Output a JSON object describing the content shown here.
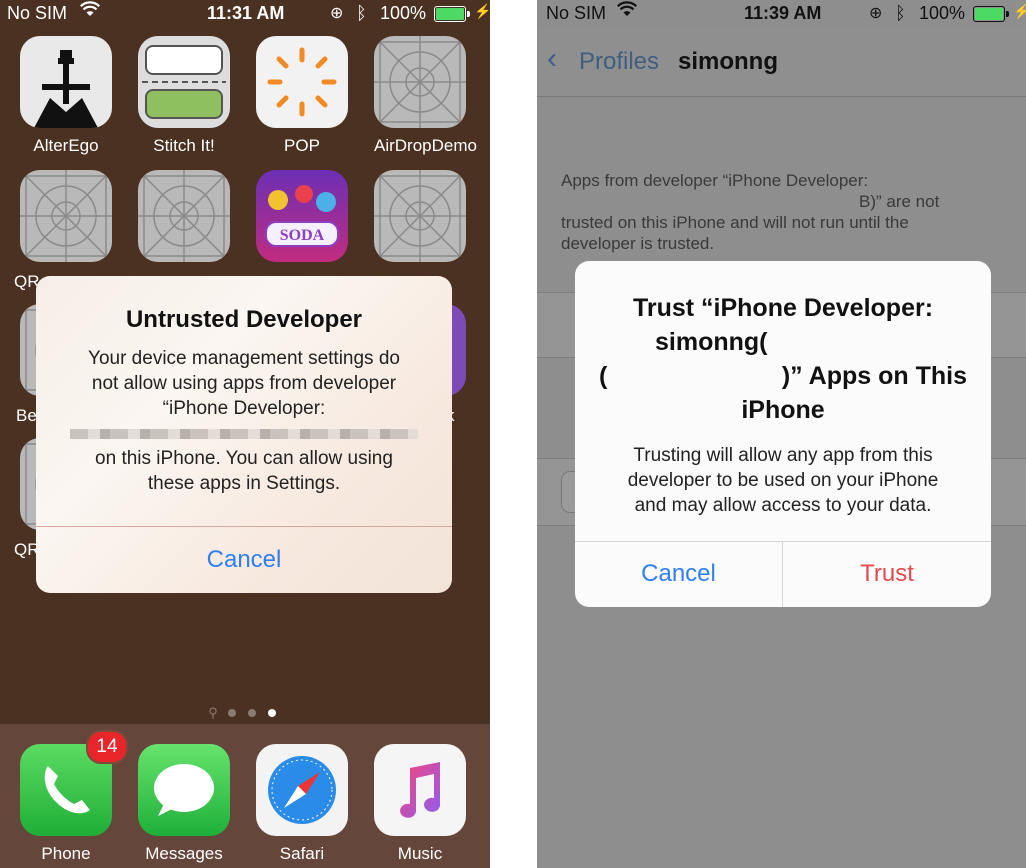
{
  "left": {
    "status": {
      "carrier": "No SIM",
      "time": "11:31 AM",
      "battery": "100%"
    },
    "apps": [
      {
        "label": "AlterEgo",
        "icon": "alterego-icon"
      },
      {
        "label": "Stitch It!",
        "icon": "stitch-icon"
      },
      {
        "label": "POP",
        "icon": "pop-icon"
      },
      {
        "label": "AirDropDemo",
        "icon": "placeholder-icon"
      },
      {
        "label": "QR",
        "icon": "placeholder-icon"
      },
      {
        "label": "",
        "icon": "placeholder-icon"
      },
      {
        "label": "",
        "icon": "candy-soda-icon"
      },
      {
        "label": "",
        "icon": "placeholder-icon"
      },
      {
        "label": "Be",
        "icon": "placeholder-icon"
      },
      {
        "label": "k",
        "icon": "purple-icon"
      },
      {
        "label": "QR",
        "icon": "placeholder-icon"
      }
    ],
    "dock": [
      {
        "label": "Phone",
        "badge": "14"
      },
      {
        "label": "Messages"
      },
      {
        "label": "Safari"
      },
      {
        "label": "Music"
      }
    ],
    "alert": {
      "title": "Untrusted Developer",
      "line1": "Your device management settings do",
      "line2": "not allow using apps from developer",
      "line3": "“iPhone Developer:",
      "line4": "on this iPhone. You can allow using",
      "line5": "these apps in Settings.",
      "cancel": "Cancel"
    }
  },
  "right": {
    "status": {
      "carrier": "No SIM",
      "time": "11:39 AM",
      "battery": "100%"
    },
    "nav": {
      "back": "Profiles",
      "title": "simonng"
    },
    "body": {
      "line1": "Apps from developer “iPhone Developer:",
      "line2": "B)” are not",
      "line3": "trusted on this iPhone and will not run until the",
      "line4": "developer is trusted."
    },
    "alert": {
      "title1": "Trust “iPhone Developer:",
      "title2": "simonng(",
      "title3": "(",
      "title3b": ")” Apps on This",
      "title4": "iPhone",
      "msg1": "Trusting will allow any app from this",
      "msg2": "developer to be used on your iPhone",
      "msg3": "and may allow access to your data.",
      "cancel": "Cancel",
      "trust": "Trust"
    },
    "colors": {
      "accent": "#2f7ef2",
      "destructive": "#e5484d"
    }
  }
}
